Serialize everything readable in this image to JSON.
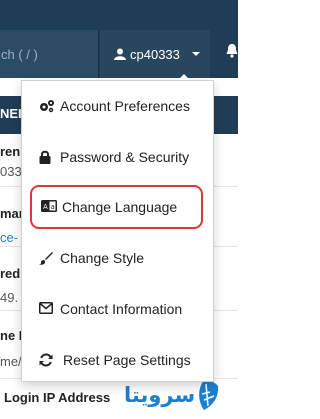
{
  "navbar": {
    "search_placeholder": "ch ( / )",
    "username": "cp40333"
  },
  "background": {
    "strip_label": "NEI",
    "rows": [
      "ren",
      "033",
      "mar",
      "ce-",
      "red",
      "49.",
      "ne N",
      "me/",
      "Login IP Address"
    ]
  },
  "menu": {
    "items": [
      {
        "label": "Account Preferences",
        "icon": "cogs-icon"
      },
      {
        "label": "Password & Security",
        "icon": "lock-icon"
      },
      {
        "label": "Change Language",
        "icon": "language-icon"
      },
      {
        "label": "Change Style",
        "icon": "paintbrush-icon"
      },
      {
        "label": "Contact Information",
        "icon": "envelope-icon"
      },
      {
        "label": "Reset Page Settings",
        "icon": "refresh-icon"
      }
    ]
  },
  "colors": {
    "navbar": "#1f3d57",
    "highlight": "#d9373b",
    "watermark": "#1e7fd0"
  },
  "watermark": {
    "text": "سرویتا"
  }
}
